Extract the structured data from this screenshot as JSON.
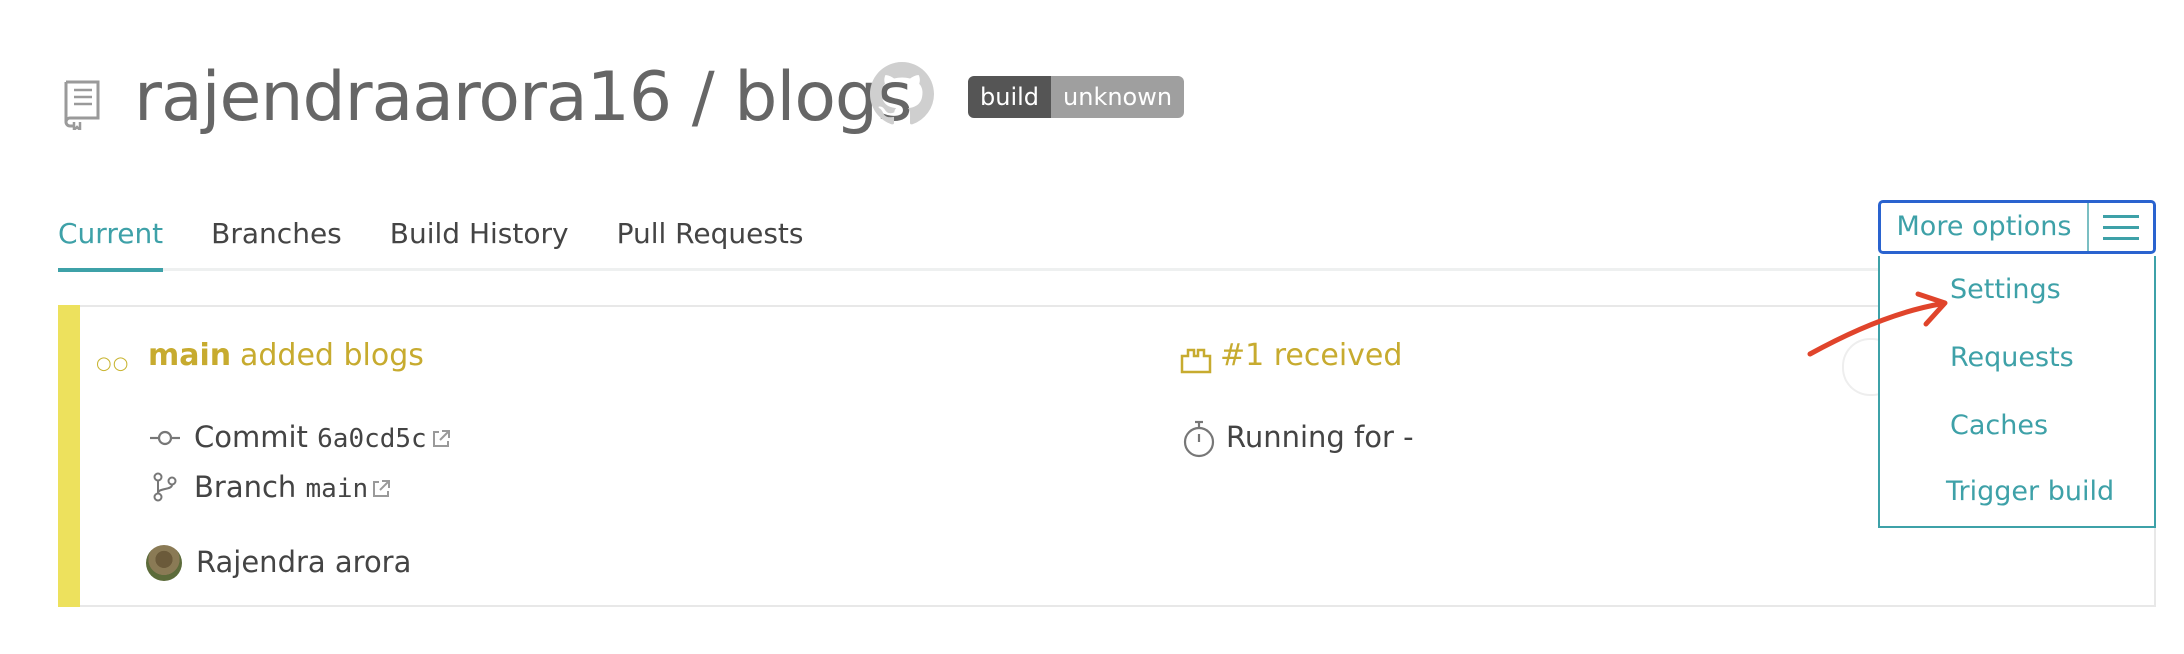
{
  "header": {
    "repo_title": "rajendraarora16 / blogs",
    "badge_left": "build",
    "badge_right": "unknown"
  },
  "tabs": [
    {
      "label": "Current",
      "active": true
    },
    {
      "label": "Branches",
      "active": false
    },
    {
      "label": "Build History",
      "active": false
    },
    {
      "label": "Pull Requests",
      "active": false
    }
  ],
  "more_options": {
    "label": "More options",
    "menu": [
      "Settings",
      "Requests",
      "Caches",
      "Trigger build"
    ]
  },
  "build": {
    "branch": "main",
    "message": "added blogs",
    "status": "#1 received",
    "commit_label": "Commit",
    "commit_hash": "6a0cd5c",
    "branch_label": "Branch",
    "branch_value": "main",
    "running": "Running for -",
    "author": "Rajendra arora"
  },
  "colors": {
    "accent": "#3ea1a8",
    "received": "#c7ab2f",
    "stripe": "#ede15d",
    "focus_border": "#2a63cf",
    "annotation_arrow": "#e0442b"
  }
}
